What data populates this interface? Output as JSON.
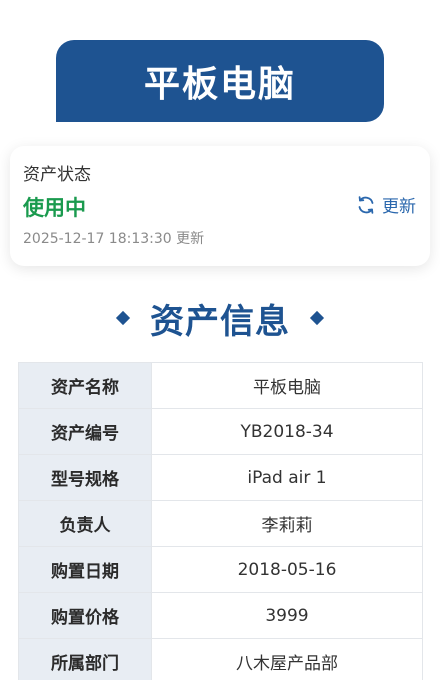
{
  "title": "平板电脑",
  "status_card": {
    "heading": "资产状态",
    "status": "使用中",
    "updated_at": "2025-12-17 18:13:30 更新",
    "refresh_label": "更新"
  },
  "section_title": "资产信息",
  "asset_info": [
    {
      "label": "资产名称",
      "value": "平板电脑"
    },
    {
      "label": "资产编号",
      "value": "YB2018-34"
    },
    {
      "label": "型号规格",
      "value": "iPad air 1"
    },
    {
      "label": "负责人",
      "value": "李莉莉"
    },
    {
      "label": "购置日期",
      "value": "2018-05-16"
    },
    {
      "label": "购置价格",
      "value": "3999"
    },
    {
      "label": "所属部门",
      "value": "八木屋产品部"
    }
  ],
  "colors": {
    "brand": "#1e5391",
    "status_ok": "#1a9a4e",
    "link": "#2a67ad"
  }
}
